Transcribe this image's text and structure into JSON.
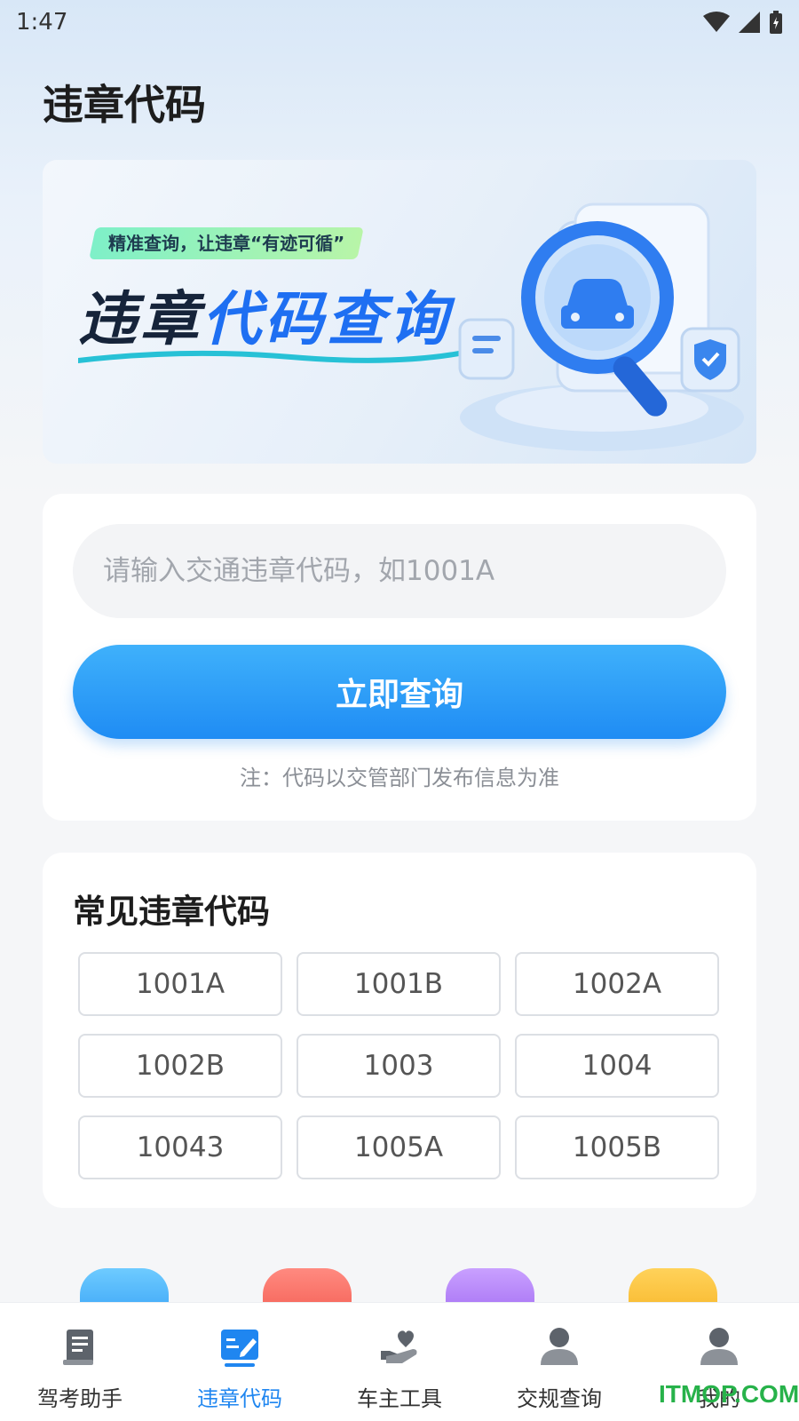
{
  "status_bar": {
    "time": "1:47"
  },
  "page_title": "违章代码",
  "banner": {
    "tag": "精准查询，让违章“有迹可循”",
    "headline_dark": "违章",
    "headline_blue": "代码查询"
  },
  "search": {
    "placeholder": "请输入交通违章代码，如1001A",
    "value": "",
    "button_label": "立即查询",
    "note": "注：代码以交管部门发布信息为准"
  },
  "common_codes": {
    "title": "常见违章代码",
    "codes": [
      "1001A",
      "1001B",
      "1002A",
      "1002B",
      "1003",
      "1004",
      "10043",
      "1005A",
      "1005B"
    ]
  },
  "bottom_nav": {
    "items": [
      {
        "label": "驾考助手",
        "icon": "exam-book-icon"
      },
      {
        "label": "违章代码",
        "icon": "violation-code-icon",
        "active": true
      },
      {
        "label": "车主工具",
        "icon": "hand-heart-icon"
      },
      {
        "label": "交规查询",
        "icon": "person-icon"
      },
      {
        "label": "我的",
        "icon": "profile-icon"
      }
    ]
  },
  "colors": {
    "accent": "#1f86f0",
    "button_top": "#3fb1fb",
    "button_bottom": "#1f8cf4"
  },
  "watermark": "ITMOP.COM"
}
